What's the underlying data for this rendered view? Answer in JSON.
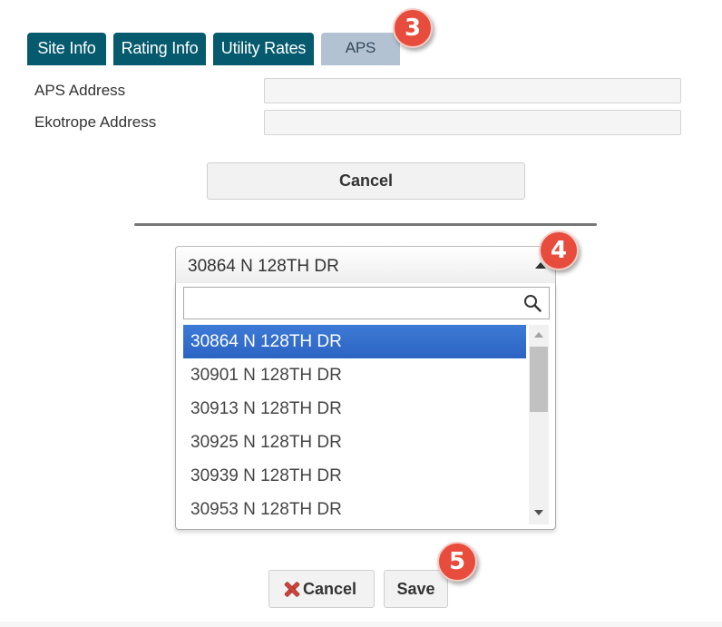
{
  "tabs": [
    {
      "label": "Site Info"
    },
    {
      "label": "Rating Info"
    },
    {
      "label": "Utility Rates"
    },
    {
      "label": "APS"
    }
  ],
  "badges": {
    "tab_aps": "3",
    "combo": "4",
    "save": "5"
  },
  "form": {
    "aps_address_label": "APS Address",
    "aps_address_value": "",
    "ekotrope_address_label": "Ekotrope Address",
    "ekotrope_address_value": ""
  },
  "cancel_wide_label": "Cancel",
  "combo": {
    "selected_value": "30864 N 128TH DR",
    "search_value": "",
    "options": [
      "30864 N 128TH DR",
      "30901 N 128TH DR",
      "30913 N 128TH DR",
      "30925 N 128TH DR",
      "30939 N 128TH DR",
      "30953 N 128TH DR"
    ]
  },
  "footer": {
    "cancel_label": "Cancel",
    "save_label": "Save"
  },
  "colors": {
    "tab_dark": "#065a6e",
    "tab_active": "#b3c2d2",
    "badge": "#e74c3c",
    "selected": "#3370cc"
  },
  "icons": {
    "search": "search-icon",
    "cancel": "close-icon",
    "combo_arrow": "triangle-up-icon"
  }
}
